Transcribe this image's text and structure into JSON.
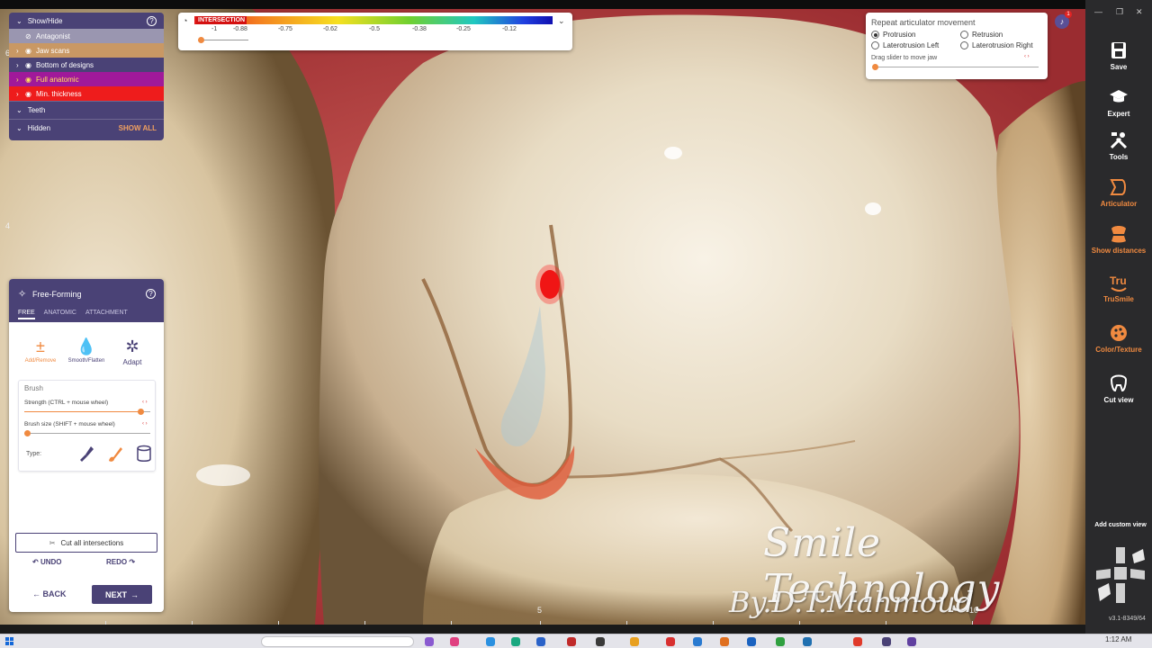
{
  "show_hide": {
    "title": "Show/Hide",
    "rows": [
      {
        "label": "Antagonist",
        "bg": "#9a96b0",
        "color": "#ffffff"
      },
      {
        "label": "Jaw scans",
        "bg": "#c99864",
        "color": "#ffffff"
      },
      {
        "label": "Bottom of designs",
        "bg": "#4a4276",
        "color": "#ffffff"
      },
      {
        "label": "Full anatomic",
        "bg": "#a0199a",
        "color": "#ffe060"
      },
      {
        "label": "Min. thickness",
        "bg": "#ee1c1c",
        "color": "#ffffff"
      }
    ],
    "teeth_label": "Teeth",
    "hidden_label": "Hidden",
    "show_all_label": "SHOW ALL"
  },
  "colormap": {
    "label": "INTERSECTION",
    "ticks": [
      "-1",
      "-0.88",
      "-0.75",
      "-0.62",
      "-0.5",
      "-0.38",
      "-0.25",
      "-0.12"
    ]
  },
  "articulator": {
    "title": "Repeat articulator movement",
    "options": [
      {
        "label": "Protrusion",
        "selected": true
      },
      {
        "label": "Retrusion",
        "selected": false
      },
      {
        "label": "Laterotrusion Left",
        "selected": false
      },
      {
        "label": "Laterotrusion Right",
        "selected": false
      }
    ],
    "hint": "Drag slider to move jaw",
    "notification_count": "1"
  },
  "toolbar": {
    "items": [
      {
        "label": "Save",
        "icon": "save-icon"
      },
      {
        "label": "Expert",
        "icon": "graduation-cap-icon"
      },
      {
        "label": "Tools",
        "icon": "tools-icon"
      },
      {
        "label": "Articulator",
        "icon": "articulator-icon"
      },
      {
        "label": "Show distances",
        "icon": "show-distances-icon"
      },
      {
        "label": "TruSmile",
        "icon": "trusmile-icon"
      },
      {
        "label": "Color/Texture",
        "icon": "palette-icon"
      },
      {
        "label": "Cut view",
        "icon": "cut-view-icon"
      }
    ],
    "custom_view_label": "Add custom view",
    "version": "v3.1-8349/64"
  },
  "freeform": {
    "title": "Free-Forming",
    "tabs": [
      "FREE",
      "ANATOMIC",
      "ATTACHMENT"
    ],
    "tools": [
      {
        "label": "Add/Remove",
        "icon": "add-remove-icon"
      },
      {
        "label": "Smooth/Flatten",
        "icon": "drop-icon"
      },
      {
        "label": "Adapt",
        "icon": "adapt-icon"
      }
    ],
    "brush_title": "Brush",
    "strength_label": "Strength (CTRL + mouse wheel)",
    "strength_value": 0.95,
    "size_label": "Brush size (SHIFT + mouse wheel)",
    "size_value": 0.0,
    "type_label": "Type:",
    "cut_label": "Cut all intersections",
    "undo_label": "UNDO",
    "redo_label": "REDO",
    "back_label": "BACK",
    "next_label": "NEXT"
  },
  "viewport": {
    "axis_labels": [
      "5",
      "10"
    ],
    "watermark_line1": "Smile Technology",
    "watermark_line2": "By.D.T.Mahmoud",
    "margin_numbers": [
      "6",
      "4"
    ]
  },
  "taskbar": {
    "clock": "1:12 AM"
  }
}
